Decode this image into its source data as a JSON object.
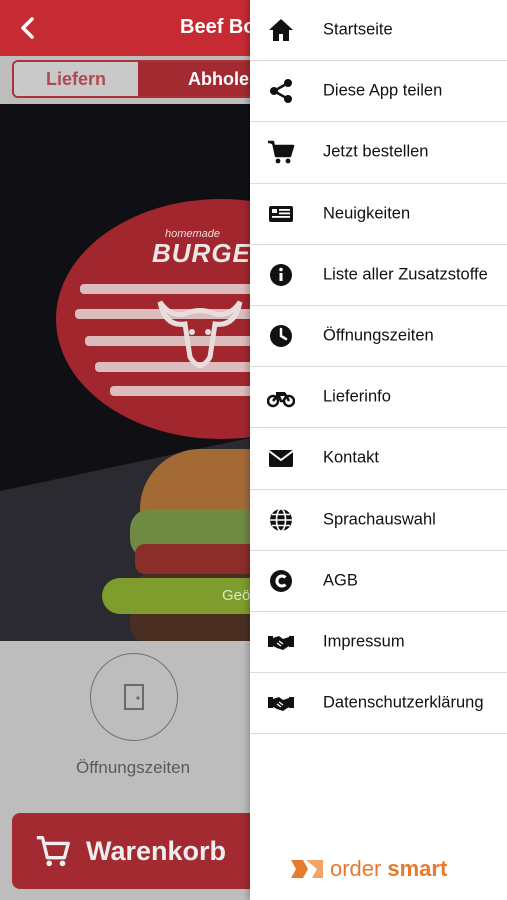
{
  "header": {
    "title": "Beef Boy"
  },
  "order_type": {
    "tabs": [
      {
        "label": "Liefern",
        "active": false
      },
      {
        "label": "Abholen",
        "active": true
      }
    ]
  },
  "hero": {
    "logo_small_text": "homemade",
    "logo_big_text": "BURGER",
    "cta_label": "Geö"
  },
  "quick_actions": {
    "hours_label": "Öffnungszeiten"
  },
  "cart": {
    "label": "Warenkorb"
  },
  "drawer": {
    "items": [
      {
        "label": "Startseite",
        "icon": "home-icon"
      },
      {
        "label": "Diese App teilen",
        "icon": "share-icon"
      },
      {
        "label": "Jetzt bestellen",
        "icon": "cart-icon"
      },
      {
        "label": "Neuigkeiten",
        "icon": "news-icon"
      },
      {
        "label": "Liste aller Zusatzstoffe",
        "icon": "info-icon"
      },
      {
        "label": "Öffnungszeiten",
        "icon": "clock-icon"
      },
      {
        "label": "Lieferinfo",
        "icon": "motorcycle-icon"
      },
      {
        "label": "Kontakt",
        "icon": "envelope-icon"
      },
      {
        "label": "Sprachauswahl",
        "icon": "globe-icon"
      },
      {
        "label": "AGB",
        "icon": "copyright-icon"
      },
      {
        "label": "Impressum",
        "icon": "handshake-icon"
      },
      {
        "label": "Datenschutzerklärung",
        "icon": "handshake-icon"
      }
    ],
    "brand": {
      "word1": "order",
      "word2": "smart"
    }
  },
  "colors": {
    "brand_red": "#c62a32",
    "brand_red_dimmed": "#a32a30",
    "accent_orange": "#e67b2e",
    "cta_green": "#7e9d2c"
  }
}
